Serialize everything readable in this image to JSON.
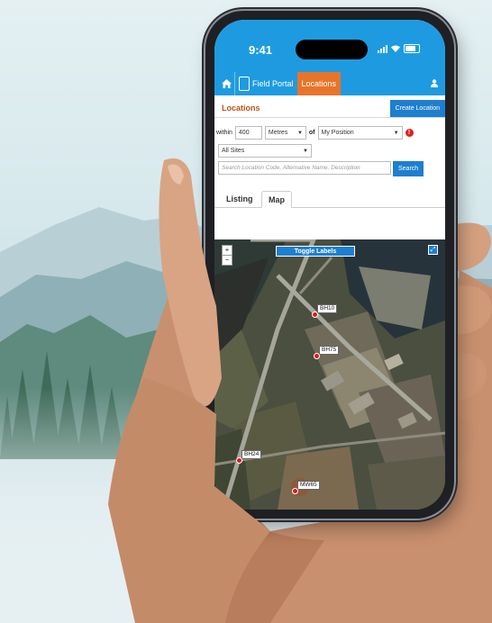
{
  "status": {
    "time": "9:41"
  },
  "appbar": {
    "brand_label": "Field Portal",
    "active_tab": "Locations"
  },
  "locations": {
    "title": "Locations",
    "create_button": "Create Location",
    "filter": {
      "within_label": "within",
      "distance": "400",
      "unit": "Metres",
      "of_label": "of",
      "origin": "My Position",
      "sites": "All Sites"
    },
    "search": {
      "placeholder": "Search Location Code, Alternative Name, Description",
      "button": "Search"
    },
    "tabs": [
      {
        "label": "Listing"
      },
      {
        "label": "Map"
      }
    ]
  },
  "map": {
    "zoom_in": "+",
    "zoom_out": "−",
    "toggle_labels": "Toggle Labels",
    "markers": [
      {
        "code": "BH10"
      },
      {
        "code": "BH75"
      },
      {
        "code": "BH24"
      },
      {
        "code": "MW65"
      }
    ],
    "marker_color": "#e01818"
  },
  "colors": {
    "primary": "#1e9be0",
    "accent": "#e8742a",
    "button": "#1e7fcf"
  }
}
